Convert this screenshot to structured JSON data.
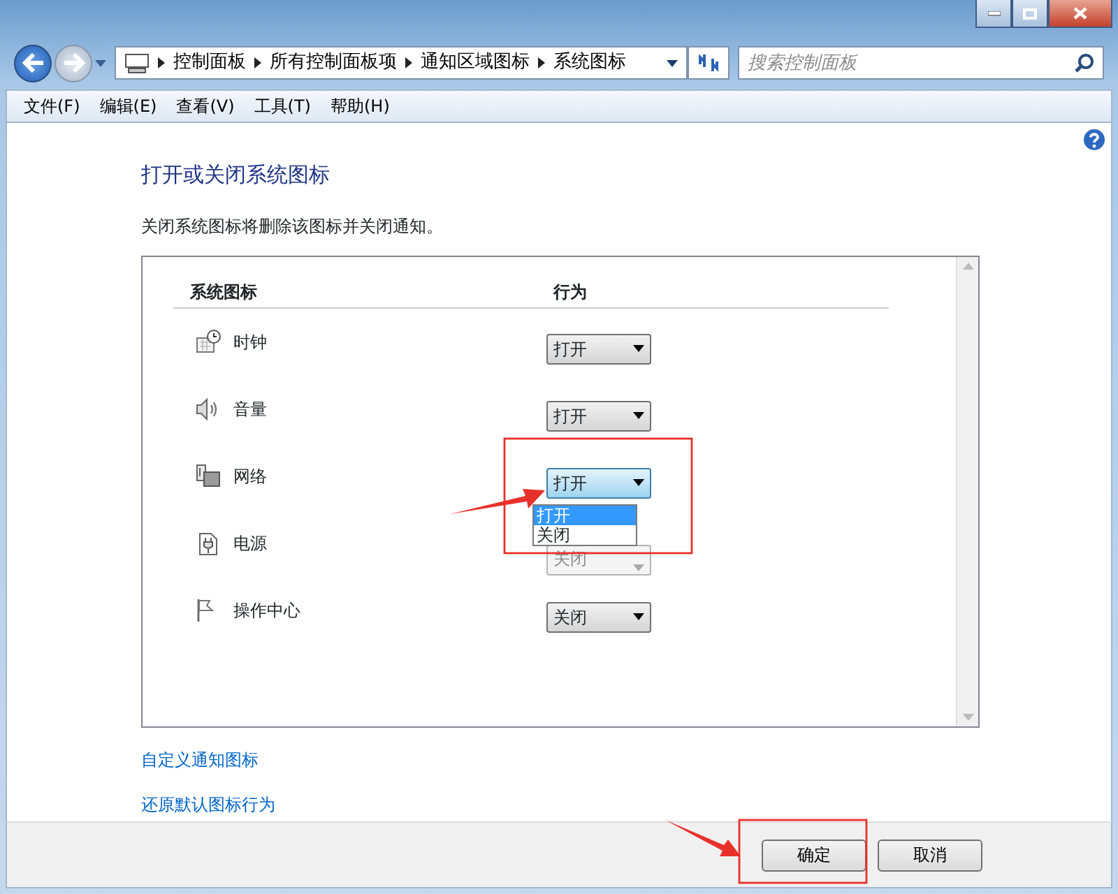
{
  "address_bar": {
    "breadcrumbs": [
      "控制面板",
      "所有控制面板项",
      "通知区域图标",
      "系统图标"
    ]
  },
  "search": {
    "placeholder": "搜索控制面板"
  },
  "menu": [
    "文件(F)",
    "编辑(E)",
    "查看(V)",
    "工具(T)",
    "帮助(H)"
  ],
  "heading": "打开或关闭系统图标",
  "description": "关闭系统图标将删除该图标并关闭通知。",
  "table": {
    "columns": [
      "系统图标",
      "行为"
    ],
    "rows": [
      {
        "kind": "clock",
        "name": "时钟",
        "value": "打开",
        "disabled": false,
        "expanded": false
      },
      {
        "kind": "speaker",
        "name": "音量",
        "value": "打开",
        "disabled": false,
        "expanded": false
      },
      {
        "kind": "network",
        "name": "网络",
        "value": "打开",
        "disabled": false,
        "expanded": true,
        "options": [
          {
            "label": "打开",
            "selected": true
          },
          {
            "label": "关闭",
            "selected": false
          }
        ]
      },
      {
        "kind": "power",
        "name": "电源",
        "value": "关闭",
        "disabled": true,
        "expanded": false
      },
      {
        "kind": "flag",
        "name": "操作中心",
        "value": "关闭",
        "disabled": false,
        "expanded": false
      }
    ]
  },
  "links": [
    "自定义通知图标",
    "还原默认图标行为"
  ],
  "buttons": [
    "确定",
    "取消"
  ]
}
